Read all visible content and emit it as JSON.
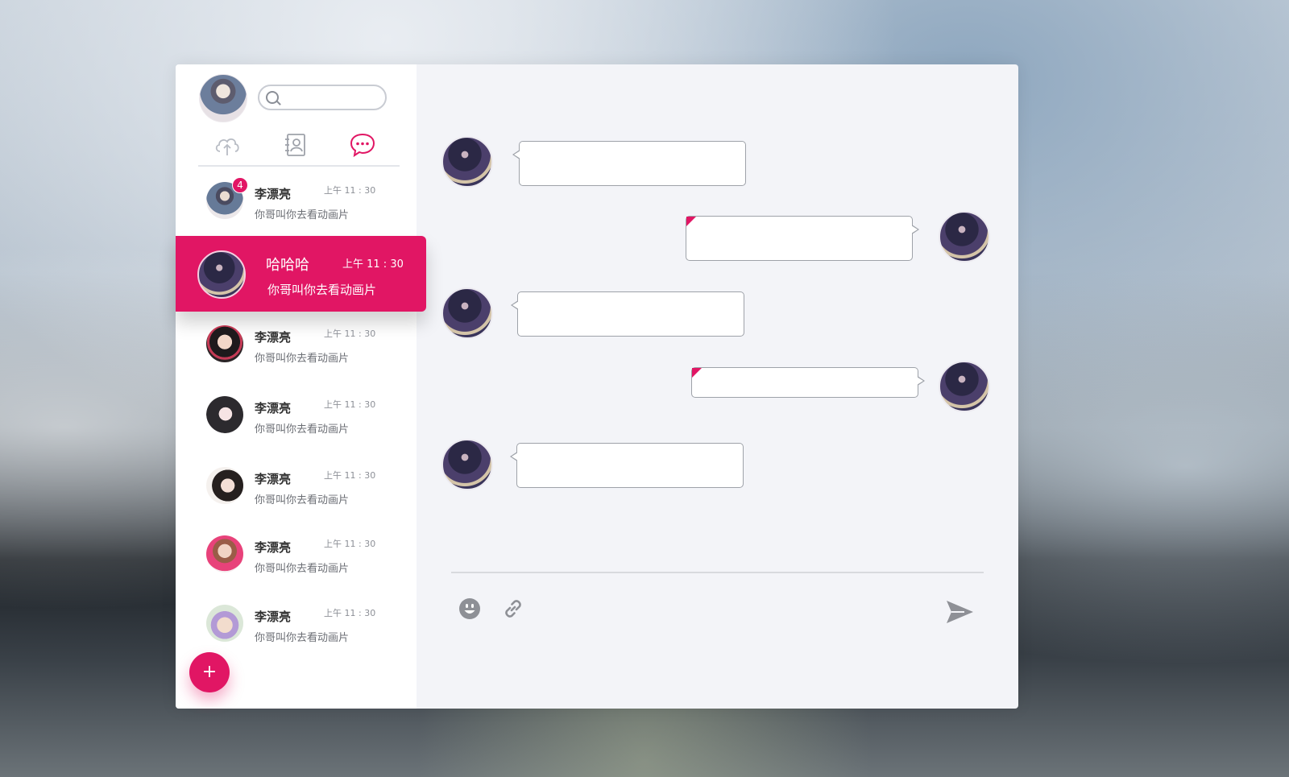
{
  "app": {
    "accent_color": "#e11664"
  },
  "sidebar": {
    "search": {
      "placeholder": "",
      "value": ""
    },
    "tabs": [
      {
        "name": "cloud",
        "icon": "cloud-upload-icon",
        "active": false
      },
      {
        "name": "contacts",
        "icon": "contacts-icon",
        "active": false
      },
      {
        "name": "chat",
        "icon": "chat-bubble-icon",
        "active": true
      }
    ],
    "conversations": [
      {
        "name": "李漂亮",
        "time": "上午 11 : 30",
        "preview": "你哥叫你去看动画片",
        "badge": "4",
        "active": false
      },
      {
        "name": "哈哈哈",
        "time": "上午 11 : 30",
        "preview": "你哥叫你去看动画片",
        "active": true
      },
      {
        "name": "李漂亮",
        "time": "上午 11 : 30",
        "preview": "你哥叫你去看动画片",
        "active": false
      },
      {
        "name": "李漂亮",
        "time": "上午 11 : 30",
        "preview": "你哥叫你去看动画片",
        "active": false
      },
      {
        "name": "李漂亮",
        "time": "上午 11 : 30",
        "preview": "你哥叫你去看动画片",
        "active": false
      },
      {
        "name": "李漂亮",
        "time": "上午 11 : 30",
        "preview": "你哥叫你去看动画片",
        "active": false
      },
      {
        "name": "李漂亮",
        "time": "上午 11 : 30",
        "preview": "你哥叫你去看动画片",
        "active": false
      }
    ],
    "fab_label": "+"
  },
  "chat": {
    "messages": [
      {
        "direction": "incoming",
        "text": ""
      },
      {
        "direction": "outgoing",
        "text": ""
      },
      {
        "direction": "incoming",
        "text": ""
      },
      {
        "direction": "outgoing",
        "text": ""
      },
      {
        "direction": "incoming",
        "text": ""
      }
    ],
    "composer": {
      "tools": [
        "emoji-icon",
        "link-icon"
      ],
      "send_icon": "send-icon"
    }
  }
}
